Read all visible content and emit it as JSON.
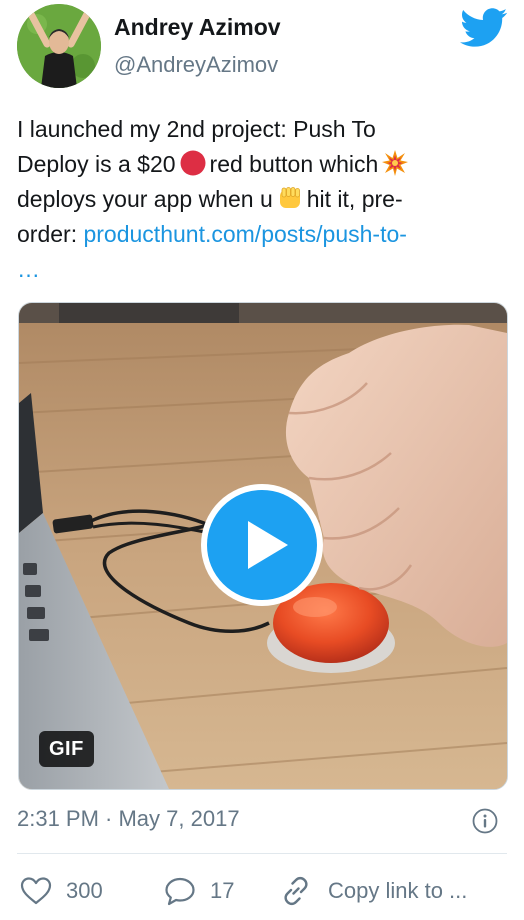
{
  "author": {
    "display_name": "Andrey Azimov",
    "handle": "@AndreyAzimov",
    "avatar_icon": "avatar-photo"
  },
  "brand": {
    "logo_icon": "twitter-bird-icon",
    "accent_color": "#1da1f2",
    "link_color": "#1b95e0"
  },
  "tweet": {
    "line1": "I launched my 2nd project: Push To",
    "line2_a": "Deploy is a $20",
    "line2_b": "red button which",
    "line3_a": "deploys your app when u",
    "line3_b": "hit it, pre-",
    "line4_a": "order:",
    "link_text": "producthunt.com/posts/push-to-",
    "line5": "…",
    "emojis": [
      "red-circle-emoji",
      "collision-emoji",
      "fist-emoji"
    ]
  },
  "media": {
    "badge": "GIF",
    "play_icon": "play-icon"
  },
  "meta": {
    "timestamp": "2:31 PM · May 7, 2017",
    "info_icon": "info-icon"
  },
  "actions": {
    "like_count": "300",
    "reply_count": "17",
    "share_label": "Copy link to ..."
  }
}
